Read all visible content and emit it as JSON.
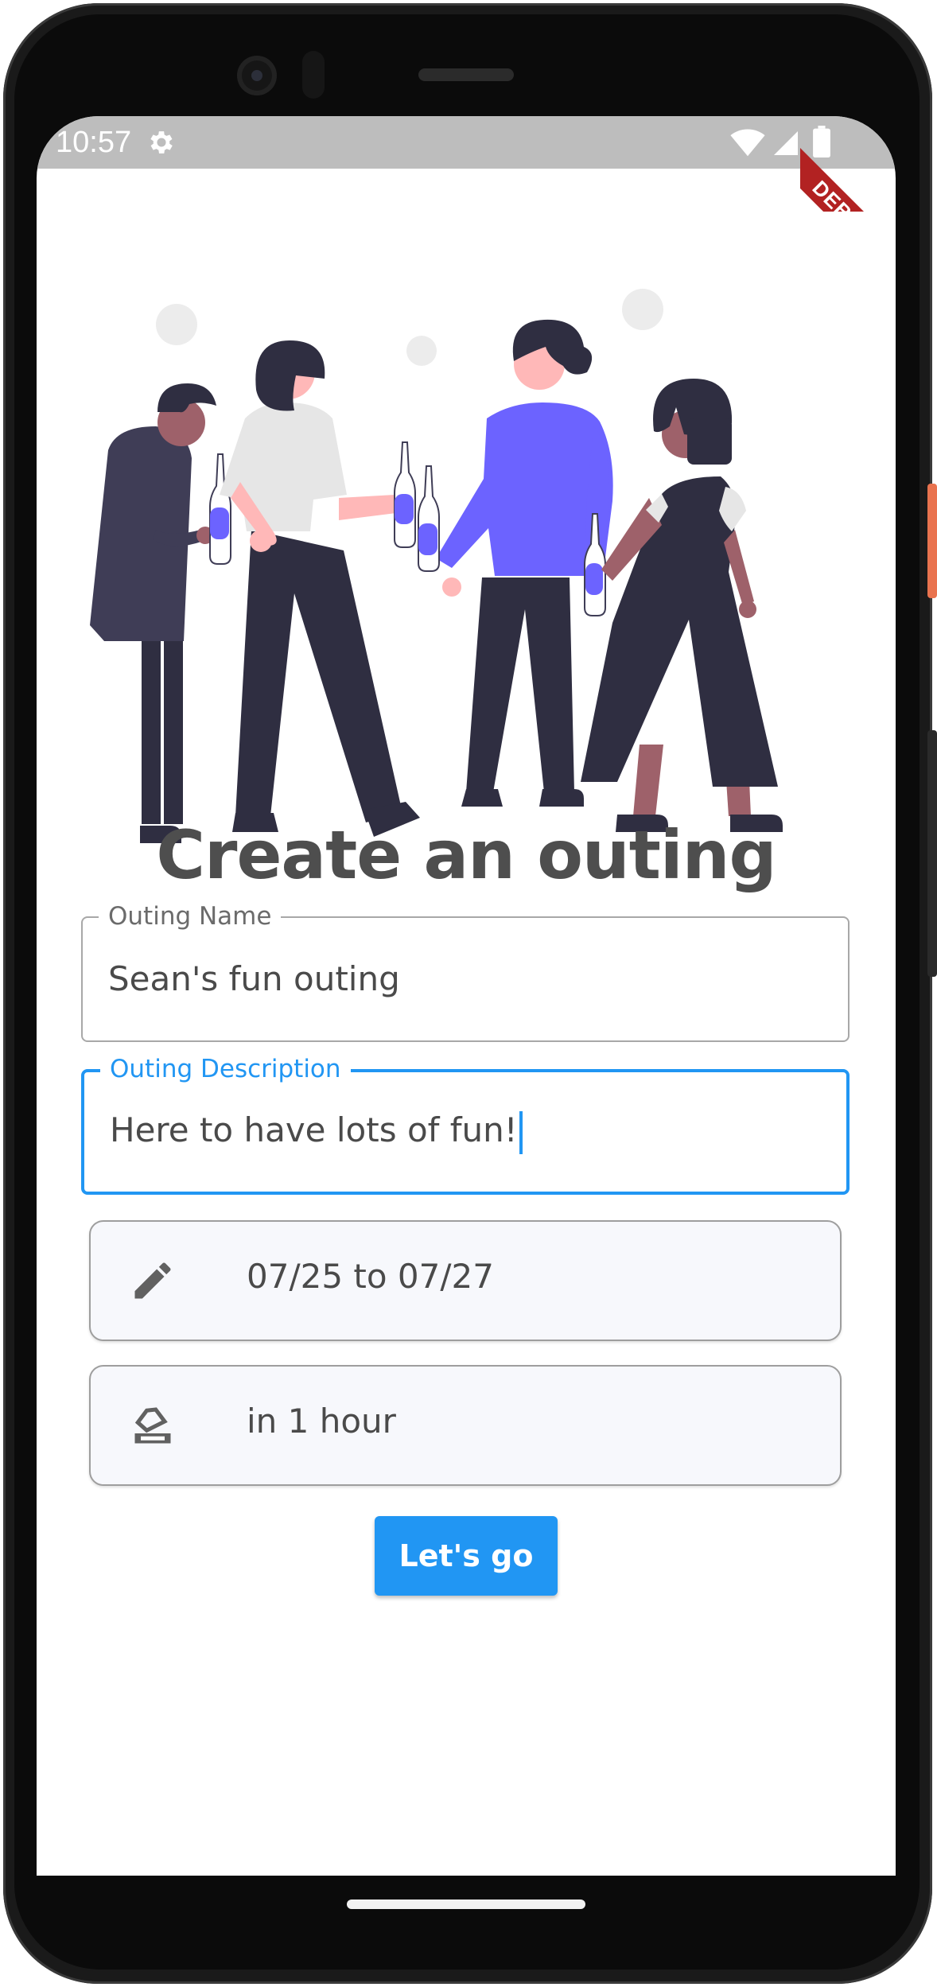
{
  "status_bar": {
    "time": "10:57"
  },
  "debug_banner": "DEBUG",
  "page": {
    "title": "Create an outing"
  },
  "form": {
    "outing_name": {
      "label": "Outing Name",
      "value": "Sean's fun outing"
    },
    "outing_description": {
      "label": "Outing Description",
      "value": "Here to have lots of fun!"
    },
    "date_range": {
      "icon": "pencil-icon",
      "value": "07/25 to 07/27"
    },
    "time": {
      "icon": "eraser-icon",
      "value": "in 1 hour"
    },
    "submit_label": "Let's go"
  },
  "colors": {
    "accent": "#2196f3",
    "illustration_purple": "#6c63ff",
    "illustration_dark": "#2f2e41",
    "debug_banner": "#b22222"
  }
}
